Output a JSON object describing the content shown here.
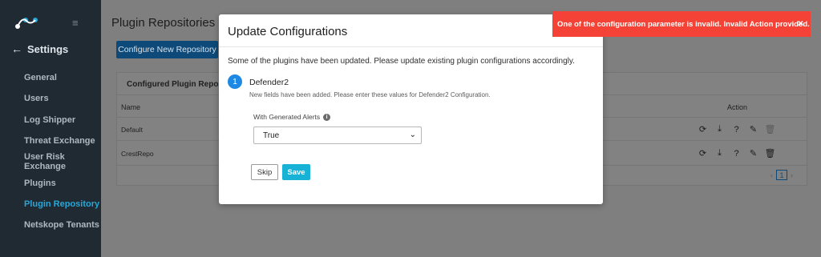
{
  "sidebar": {
    "back_label": "Settings",
    "items": [
      {
        "label": "General"
      },
      {
        "label": "Users"
      },
      {
        "label": "Log Shipper"
      },
      {
        "label": "Threat Exchange"
      },
      {
        "label": "User Risk Exchange"
      },
      {
        "label": "Plugins"
      },
      {
        "label": "Plugin Repository",
        "active": true
      },
      {
        "label": "Netskope Tenants"
      }
    ]
  },
  "main": {
    "page_title": "Plugin Repositories",
    "configure_button": "Configure New Repository",
    "card_title": "Configured Plugin Reposito",
    "columns": {
      "name": "Name",
      "action": "Action"
    },
    "rows": [
      {
        "name": "Default"
      },
      {
        "name": "CrestRepo"
      }
    ],
    "pager": {
      "page": "1"
    }
  },
  "modal": {
    "title": "Update Configurations",
    "description": "Some of the plugins have been updated. Please update existing plugin configurations accordingly.",
    "step_number": "1",
    "step_title": "Defender2",
    "step_subtitle": "New fields have been added. Please enter these values for Defender2 Configuration.",
    "field_label": "With Generated Alerts",
    "field_value": "True",
    "skip_label": "Skip",
    "save_label": "Save"
  },
  "toast": {
    "message": "One of the configuration parameter is invalid. Invalid Action provided.",
    "color": "#f44336"
  },
  "colors": {
    "sidebar_bg": "#1f2a33",
    "active": "#2aa6d6",
    "primary": "#1e88e5",
    "save": "#17b2d6"
  }
}
